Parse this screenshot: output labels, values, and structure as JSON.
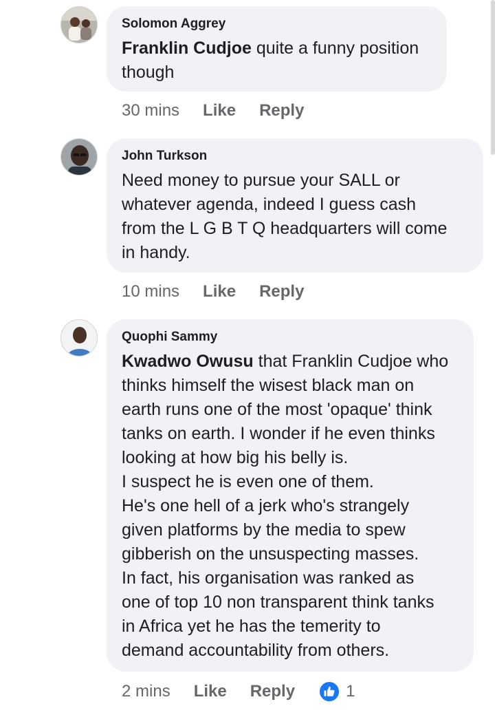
{
  "comments": [
    {
      "author": "Solomon Aggrey",
      "mention": "Franklin Cudjoe",
      "text": " quite a funny position\nthough",
      "time": "30 mins",
      "like_label": "Like",
      "reply_label": "Reply",
      "avatar_icon": "avatar-photo-icon"
    },
    {
      "author": "John Turkson",
      "text": "Need money to pursue your SALL or\nwhatever agenda, indeed  I guess cash\nfrom the L G B T Q headquarters will come\nin handy.",
      "time": "10 mins",
      "like_label": "Like",
      "reply_label": "Reply",
      "avatar_icon": "avatar-photo-icon"
    },
    {
      "author": "Quophi Sammy",
      "mention": "Kwadwo Owusu",
      "text": " that Franklin Cudjoe who\nthinks himself the wisest black man on\nearth runs one of the most 'opaque' think\ntanks on earth. I wonder if he even thinks\nlooking at how big his belly is.\nI suspect he is even one of them.\nHe's one hell of a jerk who's strangely\ngiven platforms by the media to spew\ngibberish on the unsuspecting masses.\nIn fact, his organisation was ranked as\none of top 10 non transparent think tanks\nin Africa yet he has the temerity to\ndemand accountability from others.",
      "time": "2 mins",
      "like_label": "Like",
      "reply_label": "Reply",
      "reaction_count": "1",
      "reaction_icon": "thumbs-up-icon",
      "avatar_icon": "avatar-photo-icon"
    }
  ],
  "colors": {
    "bubble": "#f0f2f5",
    "meta": "#65676b",
    "like_blue": "#1877f2"
  }
}
